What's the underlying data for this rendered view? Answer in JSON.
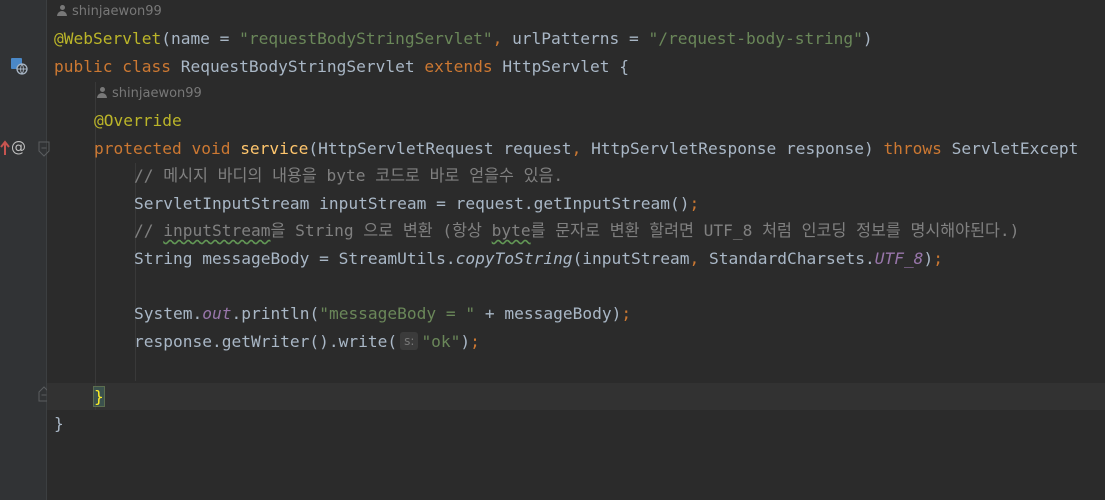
{
  "author_hints": [
    "shinjaewon99",
    "shinjaewon99"
  ],
  "code": {
    "line1": {
      "annotation": "@WebServlet",
      "p1": "(name = ",
      "s1": "\"requestBodyStringServlet\"",
      "c1": ", ",
      "p2": "urlPatterns = ",
      "s2": "\"/request-body-string\"",
      "p3": ")"
    },
    "line2": {
      "kw1": "public class ",
      "name": "RequestBodyStringServlet ",
      "kw2": "extends ",
      "parent": "HttpServlet {"
    },
    "line3": {
      "annotation": "@Override"
    },
    "line4": {
      "kw1": "protected void ",
      "method": "service",
      "p1": "(HttpServletRequest request",
      "c1": ", ",
      "p2": "HttpServletResponse response) ",
      "kw2": "throws ",
      "p3": "ServletExcept"
    },
    "line5": {
      "comment": "// 메시지 바디의 내용을 byte 코드로 바로 얻을수 있음."
    },
    "line6": {
      "code": "ServletInputStream inputStream = request.getInputStream()",
      "semi": ";"
    },
    "line7": {
      "c1": "// ",
      "t1": "inputStream",
      "c2": "을 String 으로 변환 (항상 ",
      "t2": "byte",
      "c3": "를 문자로 변환 할려면 UTF_8 처럼 인코딩 정보를 명시해야된다.)"
    },
    "line8": {
      "p1": "String messageBody = StreamUtils.",
      "method": "copyToString",
      "p2": "(inputStream",
      "c1": ", ",
      "p3": "StandardCharsets.",
      "const": "UTF_8",
      "p4": ")",
      "semi": ";"
    },
    "line9": {
      "p1": "System.",
      "field": "out",
      "p2": ".println(",
      "s1": "\"messageBody = \"",
      "p3": " + messageBody)",
      "semi": ";"
    },
    "line10": {
      "p1": "response.getWriter().write(",
      "param_hint": "s:",
      "s1": "\"ok\"",
      "p2": ")",
      "semi": ";"
    },
    "line11": {
      "brace": "}"
    },
    "line12": {
      "brace": "}"
    }
  },
  "gutter_icons": [
    "servlet-web-icon",
    "override-up-arrow-icon",
    "at-sign-icon",
    "fold-start-icon",
    "fold-end-icon"
  ],
  "colors": {
    "background": "#2b2b2b",
    "keyword": "#cc7832",
    "string": "#6a8759",
    "annotation": "#bbb529",
    "comment": "#808080",
    "method": "#ffc66d",
    "static_field": "#9876aa"
  }
}
